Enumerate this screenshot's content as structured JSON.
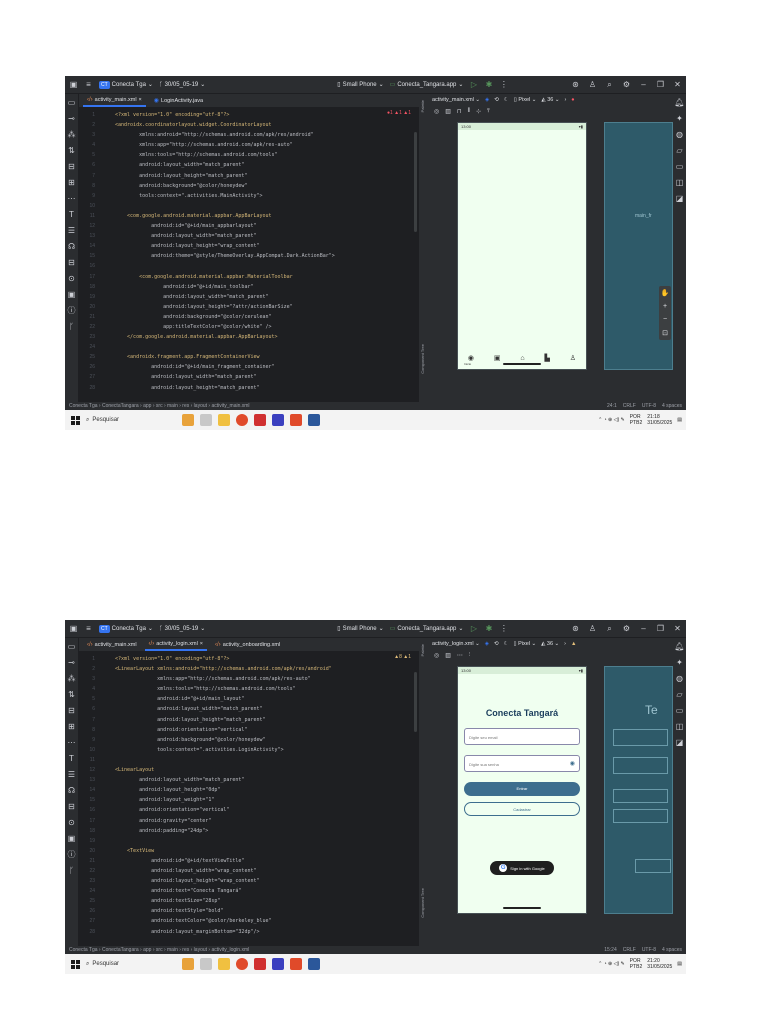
{
  "screens": [
    {
      "titlebar": {
        "project": "Conecta Tga",
        "project_badge": "CT",
        "branch": "30/05_05-19",
        "device": "Small Phone",
        "run_config": "Conecta_Tangara.app"
      },
      "tabs": [
        {
          "label": "activity_main.xml",
          "type": "xml",
          "active": true
        },
        {
          "label": "LoginActivity.java",
          "type": "java",
          "active": false
        }
      ],
      "inspections": "●1 ▲1 ▲1",
      "code_lines": [
        "<?xml version=\"1.0\" encoding=\"utf-8\"?>",
        "<androidx.coordinatorlayout.widget.CoordinatorLayout",
        "        xmlns:android=\"http://schemas.android.com/apk/res/android\"",
        "        xmlns:app=\"http://schemas.android.com/apk/res-auto\"",
        "        xmlns:tools=\"http://schemas.android.com/tools\"",
        "        android:layout_width=\"match_parent\"",
        "        android:layout_height=\"match_parent\"",
        "        android:background=\"@color/honeydew\"",
        "        tools:context=\".activities.MainActivity\">",
        "",
        "    <com.google.android.material.appbar.AppBarLayout",
        "            android:id=\"@+id/main_appbarlayout\"",
        "            android:layout_width=\"match_parent\"",
        "            android:layout_height=\"wrap_content\"",
        "            android:theme=\"@style/ThemeOverlay.AppCompat.Dark.ActionBar\">",
        "",
        "        <com.google.android.material.appbar.MaterialToolbar",
        "                android:id=\"@+id/main_toolbar\"",
        "                android:layout_width=\"match_parent\"",
        "                android:layout_height=\"?attr/actionBarSize\"",
        "                android:background=\"@color/cerulean\"",
        "                app:titleTextColor=\"@color/white\" />",
        "    </com.google.android.material.appbar.AppBarLayout>",
        "",
        "    <androidx.fragment.app.FragmentContainerView",
        "            android:id=\"@+id/main_fragment_container\"",
        "            android:layout_width=\"match_parent\"",
        "            android:layout_height=\"match_parent\""
      ],
      "design": {
        "file": "activity_main.xml",
        "device": "Pixel",
        "api": "36",
        "phone_time": "13:00",
        "nav_label": "Início",
        "blueprint_label": "main_fr"
      },
      "breadcrumb": [
        "Conecta Tga",
        "ConectaTangara",
        "app",
        "src",
        "main",
        "res",
        "layout",
        "activity_main.xml"
      ],
      "status_right": [
        "24:1",
        "CRLF",
        "UTF-8",
        "4 spaces"
      ],
      "taskbar": {
        "search": "Pesquisar",
        "lang1": "POR",
        "lang2": "PTB2",
        "time": "21:18",
        "date": "31/05/2025"
      }
    },
    {
      "titlebar": {
        "project": "Conecta Tga",
        "project_badge": "CT",
        "branch": "30/05_05-19",
        "device": "Small Phone",
        "run_config": "Conecta_Tangara.app"
      },
      "tabs": [
        {
          "label": "activity_main.xml",
          "type": "xml",
          "active": false
        },
        {
          "label": "activity_login.xml",
          "type": "xml",
          "active": true
        },
        {
          "label": "activity_onboarding.xml",
          "type": "xml",
          "active": false
        }
      ],
      "inspections": "▲8 ▲1",
      "code_lines": [
        "<?xml version=\"1.0\" encoding=\"utf-8\"?>",
        "<LinearLayout xmlns:android=\"http://schemas.android.com/apk/res/android\"",
        "              xmlns:app=\"http://schemas.android.com/apk/res-auto\"",
        "              xmlns:tools=\"http://schemas.android.com/tools\"",
        "              android:id=\"@+id/main_layout\"",
        "              android:layout_width=\"match_parent\"",
        "              android:layout_height=\"match_parent\"",
        "              android:orientation=\"vertical\"",
        "              android:background=\"@color/honeydew\"",
        "              tools:context=\".activities.LoginActivity\">",
        "",
        "<LinearLayout",
        "        android:layout_width=\"match_parent\"",
        "        android:layout_height=\"0dp\"",
        "        android:layout_weight=\"1\"",
        "        android:orientation=\"vertical\"",
        "        android:gravity=\"center\"",
        "        android:padding=\"24dp\">",
        "",
        "    <TextView",
        "            android:id=\"@+id/textViewTitle\"",
        "            android:layout_width=\"wrap_content\"",
        "            android:layout_height=\"wrap_content\"",
        "            android:text=\"Conecta Tangará\"",
        "            android:textSize=\"28sp\"",
        "            android:textStyle=\"bold\"",
        "            android:textColor=\"@color/berkeley_blue\"",
        "            android:layout_marginBottom=\"32dp\"/>"
      ],
      "design": {
        "file": "activity_login.xml",
        "device": "Pixel",
        "api": "36",
        "phone_time": "13:00",
        "app_title": "Conecta Tangará",
        "email_placeholder": "Digite seu email",
        "password_placeholder": "Digite sua senha",
        "login_button": "Entrar",
        "register_button": "Cadastrar",
        "google_button": "Sign in with Google",
        "blueprint_label": "Te"
      },
      "breadcrumb": [
        "Conecta Tga",
        "ConectaTangara",
        "app",
        "src",
        "main",
        "res",
        "layout",
        "activity_login.xml"
      ],
      "status_right": [
        "15:24",
        "CRLF",
        "UTF-8",
        "4 spaces"
      ],
      "taskbar": {
        "search": "Pesquisar",
        "lang1": "POR",
        "lang2": "PTB2",
        "time": "21:20",
        "date": "31/05/2025"
      }
    }
  ],
  "colors": {
    "ide_bg": "#1e1f22",
    "ide_panel": "#2b2d30",
    "accent": "#3574f0",
    "honeydew": "#f0fff0",
    "blueprint": "#2e5a69",
    "button": "#3d6e8e"
  }
}
